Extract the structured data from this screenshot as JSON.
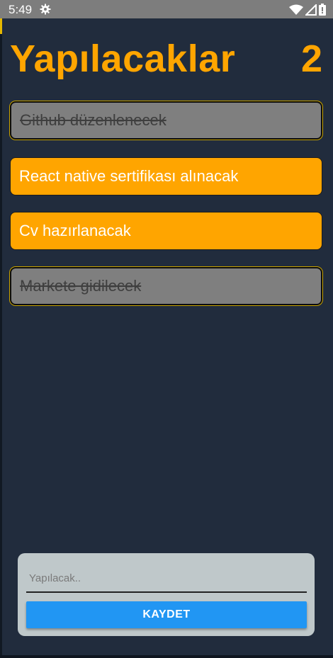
{
  "status_bar": {
    "time": "5:49",
    "icons": [
      "gear-icon",
      "wifi-icon",
      "signal-icon",
      "battery-icon"
    ]
  },
  "header": {
    "title": "Yapılacaklar",
    "pending_count": "2"
  },
  "todos": [
    {
      "text": "Github düzenlenecek",
      "done": true
    },
    {
      "text": "React native sertifikası alınacak",
      "done": false
    },
    {
      "text": "Cv hazırlanacak",
      "done": false
    },
    {
      "text": "Markete gidilecek",
      "done": true
    }
  ],
  "form": {
    "placeholder": "Yapılacak..",
    "value": "",
    "save_label": "KAYDET"
  },
  "colors": {
    "background": "#212c3d",
    "accent": "#ffa500",
    "done_item": "#7f7f7f",
    "form_card": "#bfc8ca",
    "button": "#2196f3"
  }
}
